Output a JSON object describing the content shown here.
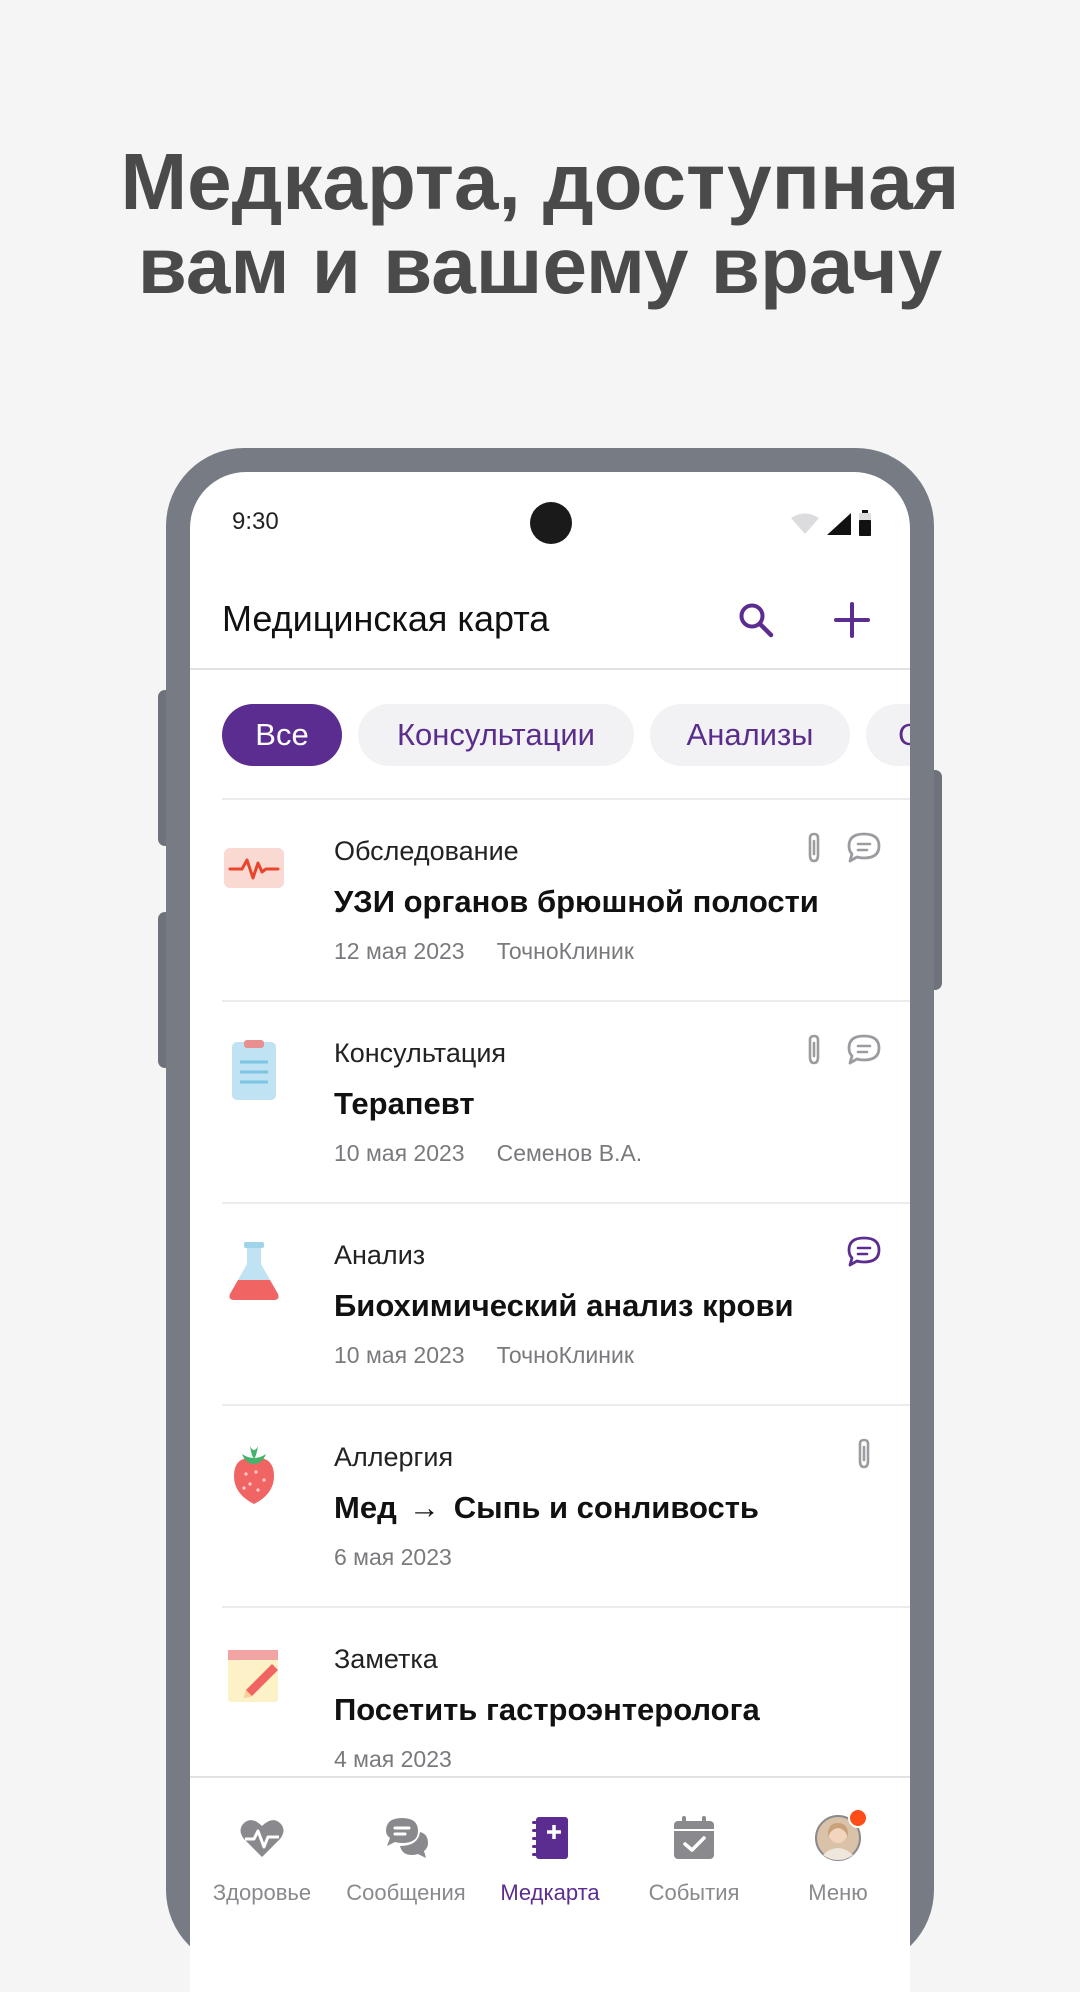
{
  "promo": {
    "line1": "Медкарта, доступная",
    "line2": "вам и вашему врачу"
  },
  "status_bar": {
    "time": "9:30"
  },
  "app_bar": {
    "title": "Медицинская карта",
    "search_icon": "search-icon",
    "add_icon": "plus-icon"
  },
  "filters": [
    {
      "label": "Все",
      "active": true
    },
    {
      "label": "Консультации",
      "active": false
    },
    {
      "label": "Анализы",
      "active": false
    },
    {
      "label": "С",
      "active": false
    }
  ],
  "records": [
    {
      "category": "Обследование",
      "title": "УЗИ органов брюшной полости",
      "date": "12 мая 2023",
      "source": "ТочноКлиник",
      "icon": "ultrasound-icon",
      "attachment": true,
      "comments": true
    },
    {
      "category": "Консультация",
      "title": "Терапевт",
      "date": "10 мая 2023",
      "source": "Семенов В.А.",
      "icon": "clipboard-icon",
      "attachment": true,
      "comments": true
    },
    {
      "category": "Анализ",
      "title": "Биохимический анализ крови",
      "date": "10 мая 2023",
      "source": "ТочноКлиник",
      "icon": "flask-icon",
      "attachment": false,
      "comments": true,
      "comments_highlight": true
    },
    {
      "category": "Аллергия",
      "title_from": "Мед",
      "title_to": "Сыпь и сонливость",
      "date": "6 мая 2023",
      "icon": "strawberry-icon",
      "attachment": true,
      "comments": false
    },
    {
      "category": "Заметка",
      "title": "Посетить гастроэнтеролога",
      "date": "4 мая 2023",
      "icon": "note-icon",
      "attachment": false,
      "comments": false
    }
  ],
  "bottom_nav": [
    {
      "label": "Здоровье",
      "icon": "heart-pulse-icon",
      "active": false
    },
    {
      "label": "Сообщения",
      "icon": "chat-bubbles-icon",
      "active": false
    },
    {
      "label": "Медкарта",
      "icon": "medical-book-icon",
      "active": true
    },
    {
      "label": "События",
      "icon": "calendar-check-icon",
      "active": false
    },
    {
      "label": "Меню",
      "icon": "avatar",
      "active": false,
      "badge": true
    }
  ],
  "colors": {
    "accent": "#5c2d91",
    "badge": "#ff4d1a",
    "phone_frame": "#777c84",
    "background": "#f5f5f6"
  }
}
